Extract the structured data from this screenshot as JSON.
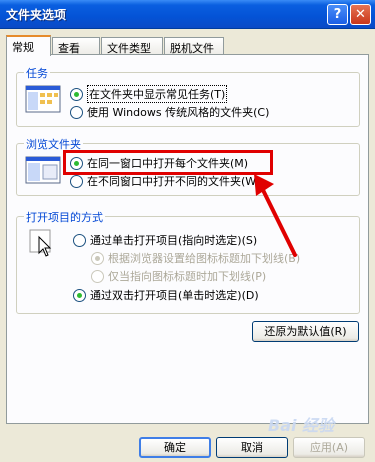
{
  "window": {
    "title": "文件夹选项",
    "help_glyph": "?",
    "close_glyph": "✕"
  },
  "tabs": [
    "常规",
    "查看",
    "文件类型",
    "脱机文件"
  ],
  "tasks": {
    "legend": "任务",
    "options": [
      {
        "label": "在文件夹中显示常见任务(T)",
        "checked": true
      },
      {
        "label": "使用 Windows 传统风格的文件夹(C)",
        "checked": false
      }
    ]
  },
  "browse": {
    "legend": "浏览文件夹",
    "options": [
      {
        "label": "在同一窗口中打开每个文件夹(M)",
        "checked": true
      },
      {
        "label": "在不同窗口中打开不同的文件夹(W)",
        "checked": false
      }
    ]
  },
  "open": {
    "legend": "打开项目的方式",
    "options": [
      {
        "label": "通过单击打开项目(指向时选定)(S)",
        "checked": false,
        "enabled": true
      },
      {
        "label": "根据浏览器设置给图标标题加下划线(B)",
        "checked": true,
        "enabled": false
      },
      {
        "label": "仅当指向图标标题时加下划线(P)",
        "checked": false,
        "enabled": false
      },
      {
        "label": "通过双击打开项目(单击时选定)(D)",
        "checked": true,
        "enabled": true
      }
    ]
  },
  "restore_button": "还原为默认值(R)",
  "footer": {
    "ok": "确定",
    "cancel": "取消",
    "apply": "应用(A)"
  },
  "watermark": "Bai 经验",
  "colors": {
    "accent_red": "#e00000",
    "title_blue": "#0453d6",
    "legend_blue": "#0046d5"
  }
}
